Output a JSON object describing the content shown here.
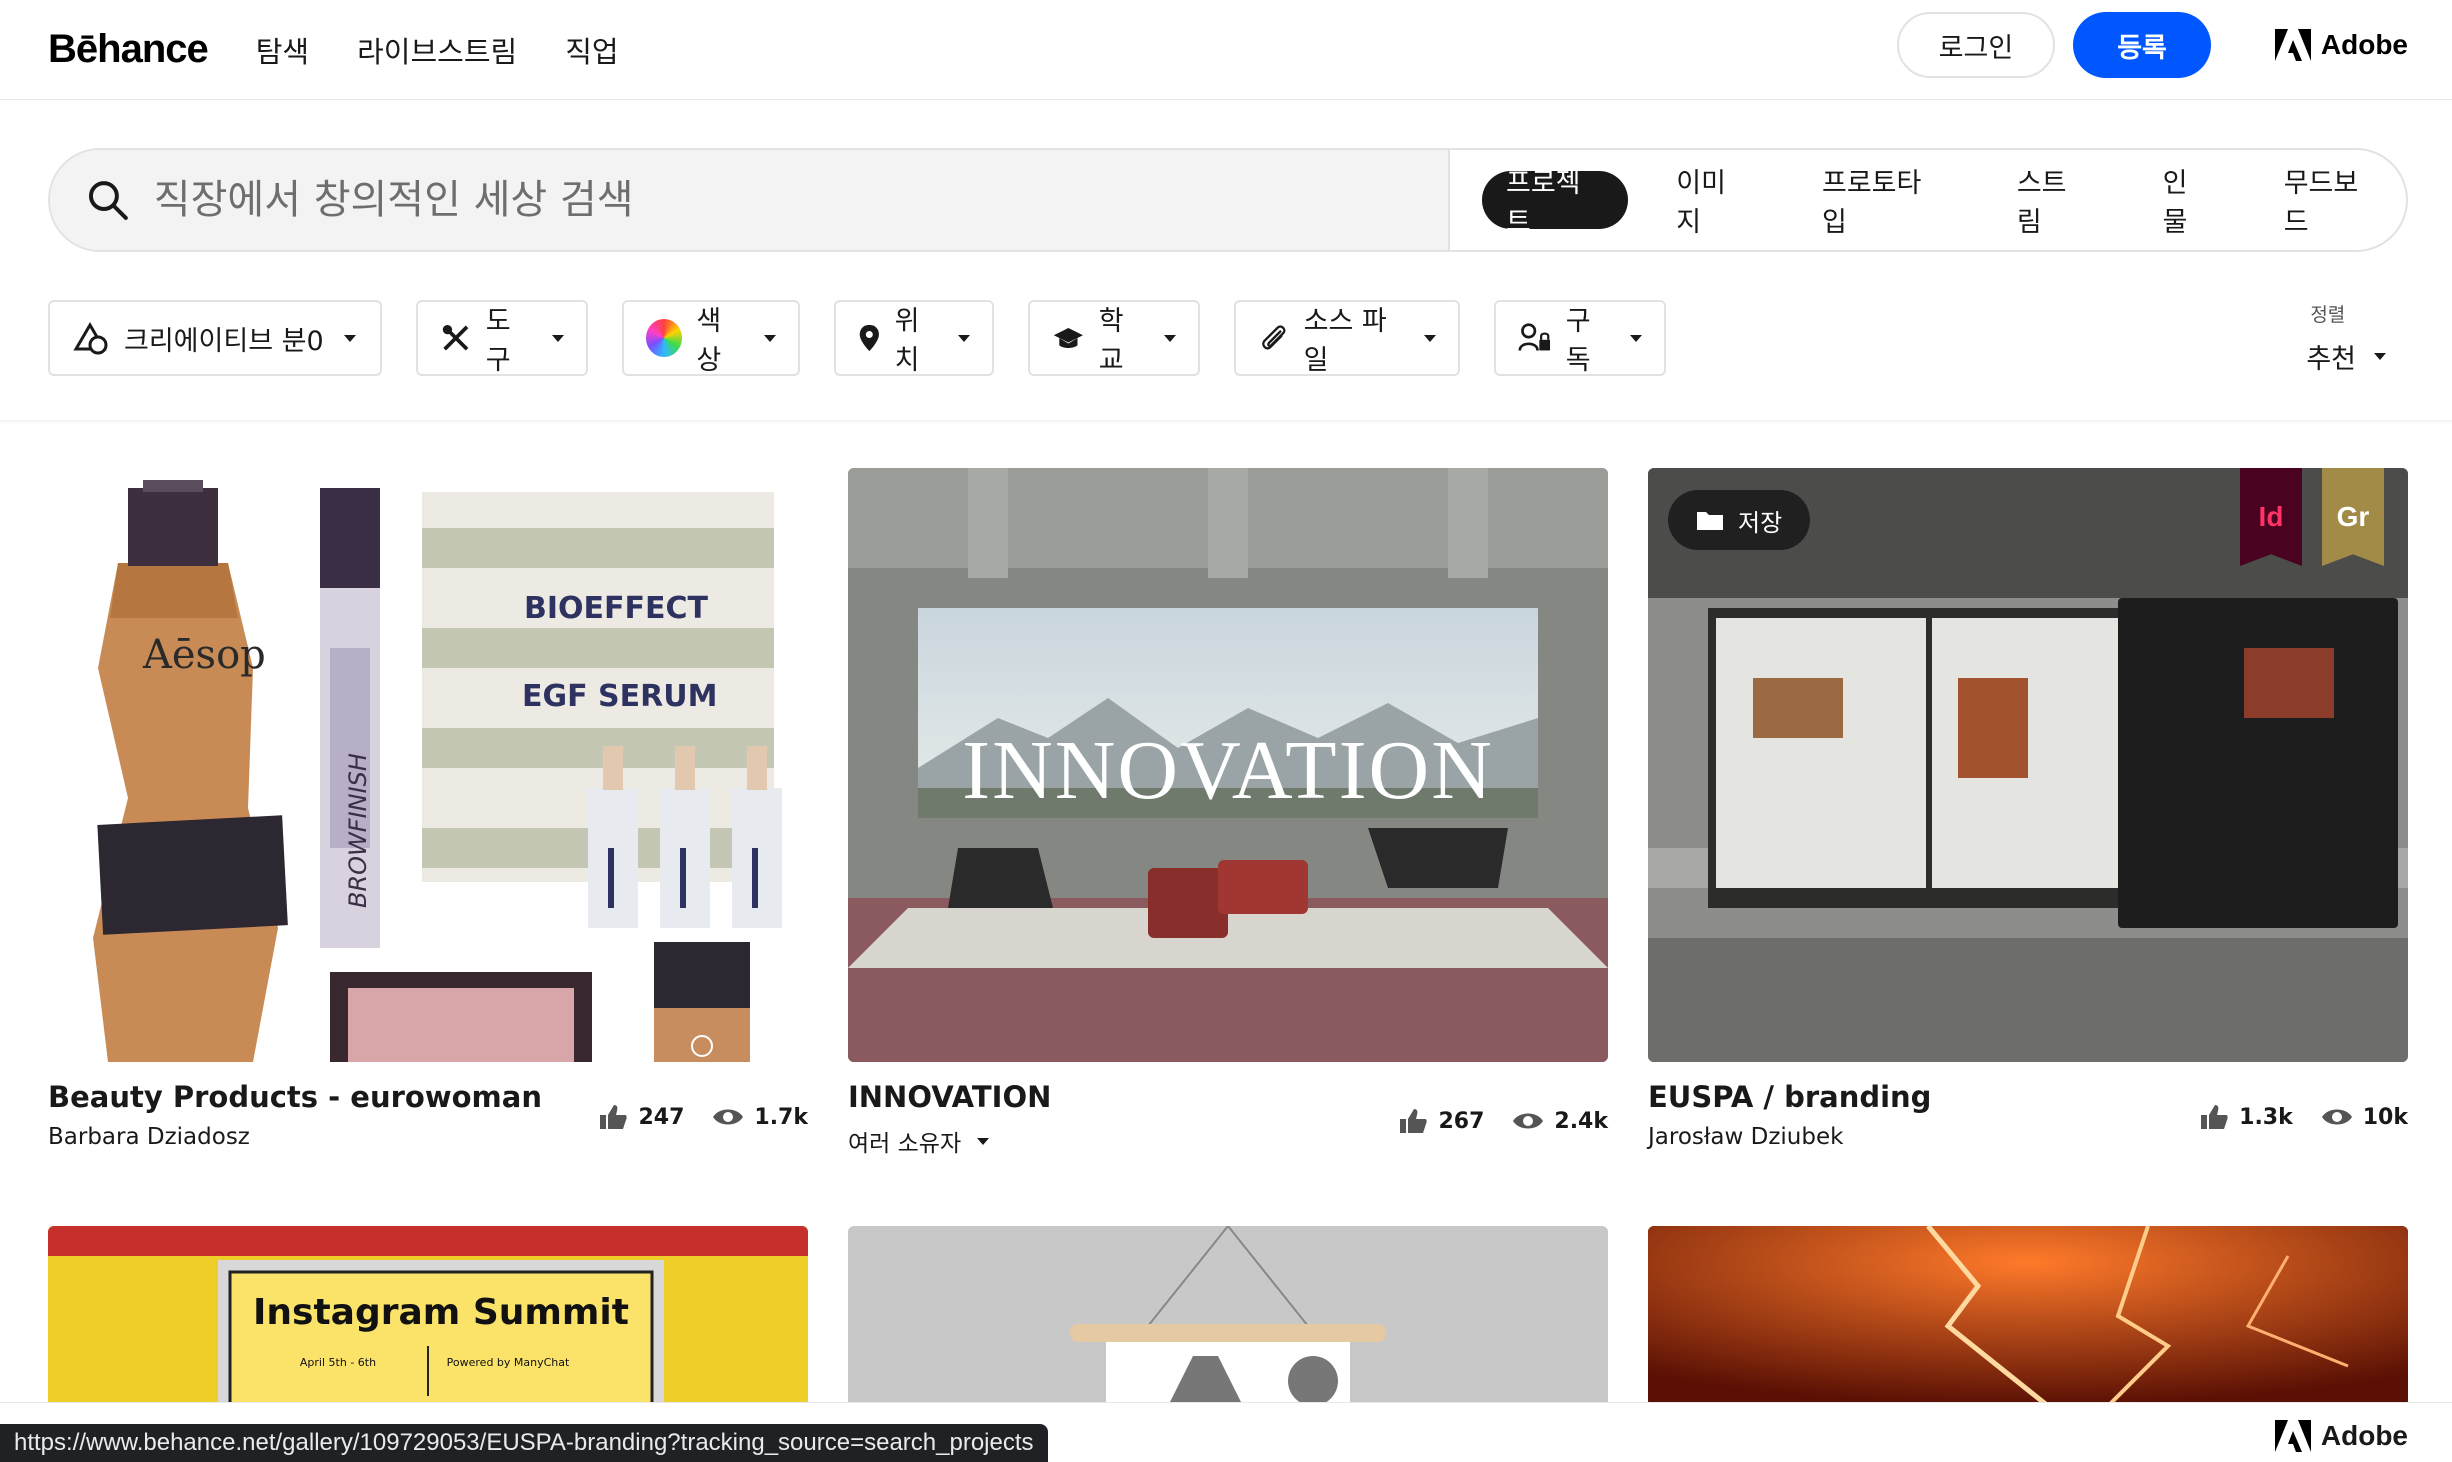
{
  "nav": {
    "logo": "Bēhance",
    "links": [
      "탐색",
      "라이브스트림",
      "직업"
    ],
    "login": "로그인",
    "signup": "등록",
    "adobe": "Adobe"
  },
  "search": {
    "placeholder": "직장에서 창의적인 세상 검색",
    "tabs": [
      "프로젝트",
      "이미지",
      "프로토타입",
      "스트림",
      "인물",
      "무드보드"
    ],
    "active_tab": "프로젝트"
  },
  "filters": [
    "크리에이티브 분0",
    "도구",
    "색상",
    "위치",
    "학교",
    "소스 파일",
    "구독"
  ],
  "sort": {
    "label": "정렬",
    "value": "추천"
  },
  "projects": [
    {
      "title": "Beauty Products - eurowoman",
      "owner": "Barbara Dziadosz",
      "likes": "247",
      "views": "1.7k"
    },
    {
      "title": "INNOVATION",
      "owner": "여러 소유자",
      "likes": "267",
      "views": "2.4k",
      "overlay": "INNOVATION"
    },
    {
      "title": "EUSPA / branding",
      "owner": "Jarosław Dziubek",
      "likes": "1.3k",
      "views": "10k",
      "save": "저장",
      "badges": [
        "Id",
        "Gr"
      ]
    }
  ],
  "thumb_text": {
    "bioeffect": "BIOEFFECT",
    "egf": "EGF SERUM",
    "aesop": "Aēsop",
    "browfinish": "BROWFINISH",
    "instagram": "Instagram Summit",
    "summit_dates": "April 5th - 6th",
    "summit_by": "Powered by ManyChat"
  },
  "colors": {
    "accent": "#0057ff",
    "dark": "#191919"
  },
  "status": {
    "url": "https://www.behance.net/gallery/109729053/EUSPA-branding?tracking_source=search_projects",
    "adobe": "Adobe"
  }
}
